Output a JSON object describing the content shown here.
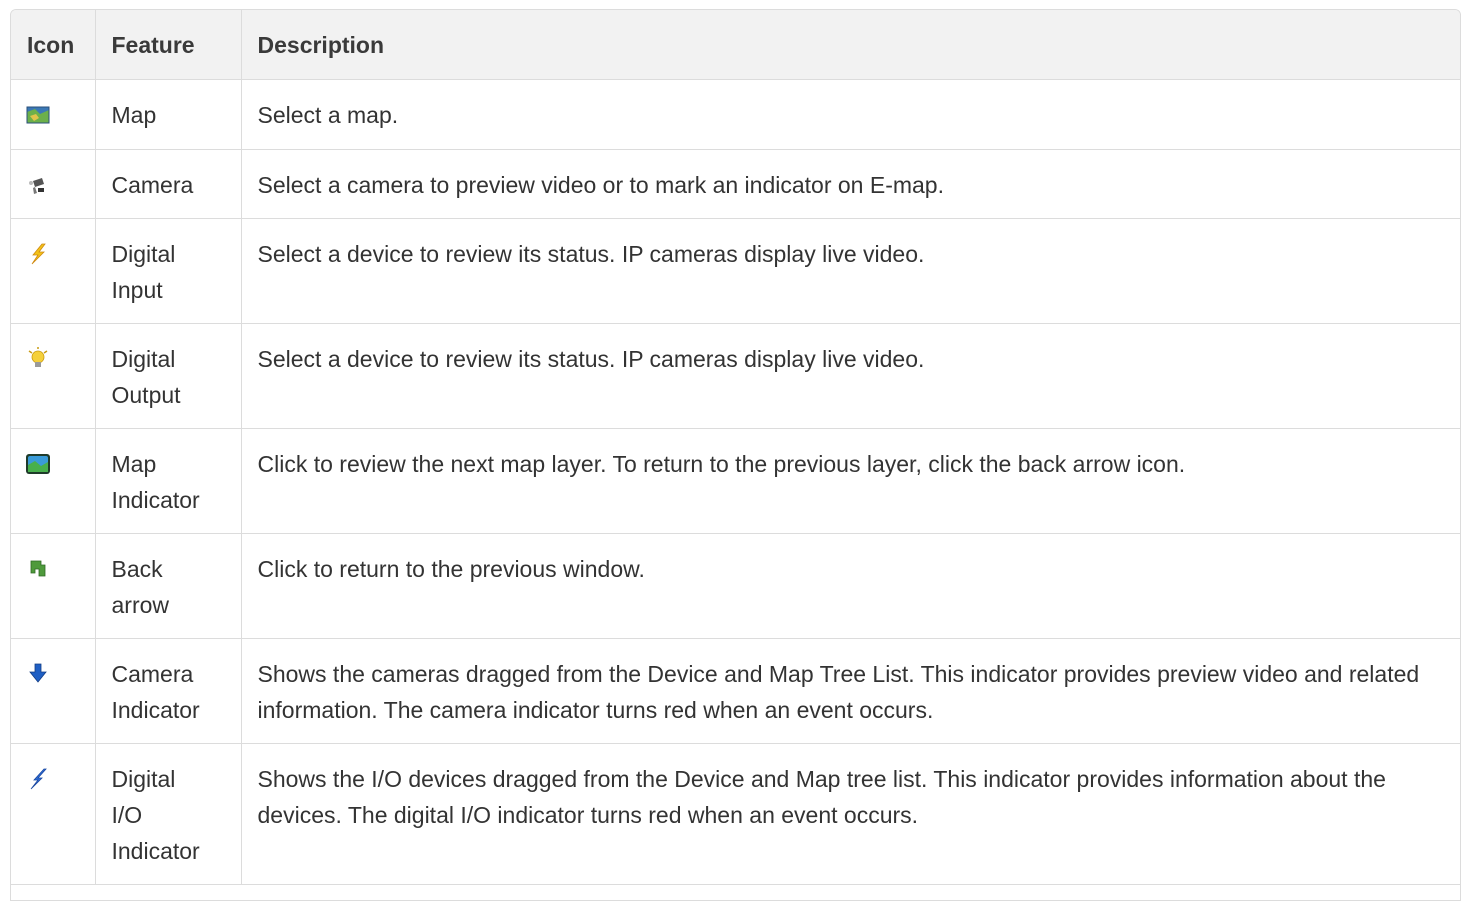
{
  "table": {
    "headers": {
      "icon": "Icon",
      "feature": "Feature",
      "description": "Description"
    },
    "rows": [
      {
        "icon": "map-icon",
        "feature_lines": [
          "Map"
        ],
        "description": "Select a map."
      },
      {
        "icon": "camera-icon",
        "feature_lines": [
          "Camera"
        ],
        "description": "Select a camera to preview video or to mark an indicator on E-map."
      },
      {
        "icon": "digital-input-icon",
        "feature_lines": [
          "Digital",
          "Input"
        ],
        "description": "Select a device to review its status. IP cameras display live video."
      },
      {
        "icon": "digital-output-icon",
        "feature_lines": [
          "Digital",
          "Output"
        ],
        "description": "Select a device to review its status. IP cameras display live video."
      },
      {
        "icon": "map-indicator-icon",
        "feature_lines": [
          "Map",
          "Indicator"
        ],
        "description": "Click to review the next map layer. To return to the previous layer, click the back arrow icon."
      },
      {
        "icon": "back-arrow-icon",
        "feature_lines": [
          "Back",
          "arrow"
        ],
        "description": "Click to return to the previous window."
      },
      {
        "icon": "camera-indicator-icon",
        "feature_lines": [
          "Camera",
          "Indicator"
        ],
        "description": "Shows the cameras dragged from the Device and Map Tree List. This indicator provides preview video and related information. The camera indicator turns red when an event occurs."
      },
      {
        "icon": "digital-io-indicator-icon",
        "feature_lines": [
          "Digital",
          "I/O",
          "Indicator"
        ],
        "description": "Shows the I/O devices dragged from the Device and Map tree list. This indicator provides information about the devices. The digital I/O indicator turns red when an event occurs."
      }
    ]
  }
}
